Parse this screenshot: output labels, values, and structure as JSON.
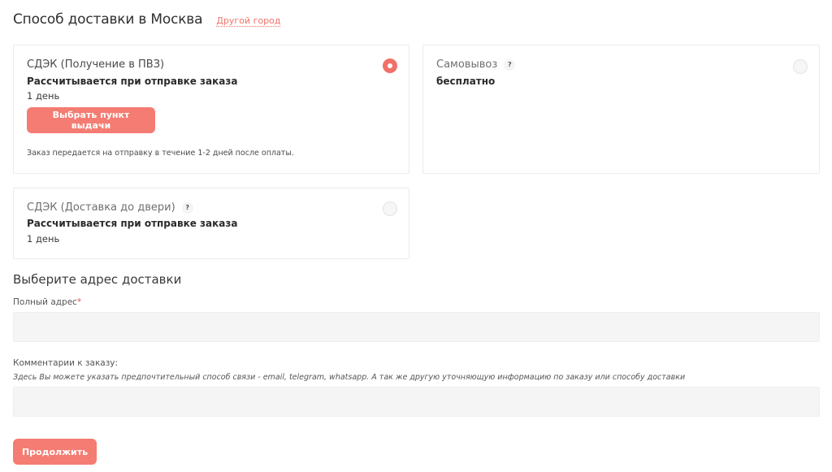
{
  "header": {
    "title": "Способ доставки в Москва",
    "city_link": "Другой город"
  },
  "options": [
    {
      "name": "СДЭК (Получение в ПВЗ)",
      "price": "Рассчитывается при отправке заказа",
      "days": "1 день",
      "button": "Выбрать пункт выдачи",
      "note": "Заказ передается на отправку в течение 1-2 дней после оплаты.",
      "selected": true
    },
    {
      "name": "Самовывоз",
      "help": "?",
      "price": "бесплатно",
      "selected": false
    },
    {
      "name": "СДЭК (Доставка до двери)",
      "help": "?",
      "price": "Рассчитывается при отправке заказа",
      "days": "1 день",
      "selected": false
    }
  ],
  "address": {
    "section_title": "Выберите адрес доставки",
    "label": "Полный адрес",
    "required_mark": "*",
    "value": ""
  },
  "comment": {
    "label": "Комментарии к заказу:",
    "hint": "Здесь Вы можете указать предпочтительный способ связи - email, telegram, whatsapp. А так же другую уточняющую информацию по заказу или способу доставки",
    "value": ""
  },
  "continue_button": "Продолжить",
  "colors": {
    "accent": "#f47c72",
    "field_bg": "#f5f5f5",
    "border": "#ebebeb"
  }
}
